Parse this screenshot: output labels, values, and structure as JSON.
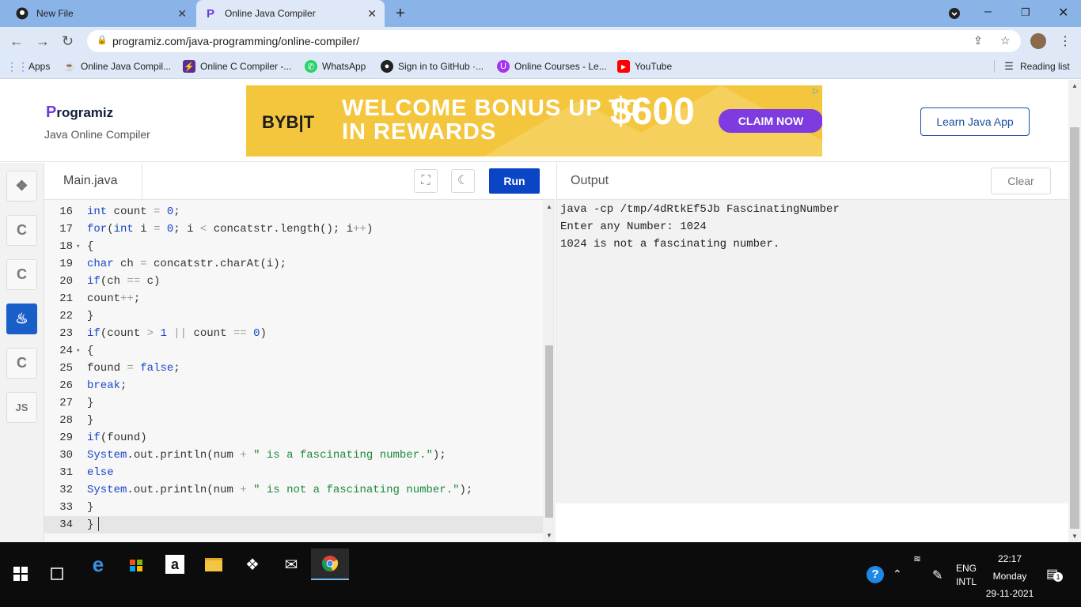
{
  "browser": {
    "tabs": [
      {
        "title": "New File"
      },
      {
        "title": "Online Java Compiler"
      }
    ],
    "url": "programiz.com/java-programming/online-compiler/",
    "bookmarks": [
      {
        "label": "Apps",
        "icon": "apps-grid-icon",
        "color": "#4285f4"
      },
      {
        "label": "Online Java Compil...",
        "icon": "java-cup-icon",
        "color": "#333333"
      },
      {
        "label": "Online C Compiler -...",
        "icon": "bolt-icon",
        "color": "#5b2d91"
      },
      {
        "label": "WhatsApp",
        "icon": "whatsapp-icon",
        "color": "#25d366"
      },
      {
        "label": "Sign in to GitHub ·...",
        "icon": "github-icon",
        "color": "#222222"
      },
      {
        "label": "Online Courses - Le...",
        "icon": "udemy-icon",
        "color": "#a435f0"
      },
      {
        "label": "YouTube",
        "icon": "youtube-icon",
        "color": "#ff0000"
      }
    ],
    "reading_list": "Reading list"
  },
  "site": {
    "logo_text": "rogramiz",
    "logo_letter": "P",
    "subtitle": "Java Online Compiler",
    "ad": {
      "brand": "BYB|T",
      "headline_1": "WELCOME BONUS UP TO",
      "headline_2": "IN REWARDS",
      "amount": "$600",
      "cta": "CLAIM NOW"
    },
    "learn_button": "Learn Java App"
  },
  "sidebar": {
    "languages": [
      {
        "name": "python",
        "glyph": "❖"
      },
      {
        "name": "c",
        "glyph": "C"
      },
      {
        "name": "cpp",
        "glyph": "C"
      },
      {
        "name": "java",
        "glyph": "♨",
        "active": true
      },
      {
        "name": "csharp",
        "glyph": "C"
      },
      {
        "name": "javascript",
        "glyph": "JS"
      }
    ]
  },
  "editor": {
    "filename": "Main.java",
    "run_label": "Run",
    "lines": [
      {
        "n": "16",
        "fold": false,
        "html": "<span class='kw'>int</span> count <span class='op'>=</span> <span class='num2'>0</span>;"
      },
      {
        "n": "17",
        "fold": false,
        "html": "<span class='kw'>for</span>(<span class='kw'>int</span> i <span class='op'>=</span> <span class='num2'>0</span>; i <span class='op'>&lt;</span> concatstr.length(); i<span class='op'>++</span>)"
      },
      {
        "n": "18",
        "fold": true,
        "html": "{"
      },
      {
        "n": "19",
        "fold": false,
        "html": "<span class='kw'>char</span> ch <span class='op'>=</span> concatstr.charAt(i);"
      },
      {
        "n": "20",
        "fold": false,
        "html": "<span class='kw'>if</span>(ch <span class='op'>==</span> c)"
      },
      {
        "n": "21",
        "fold": false,
        "html": "count<span class='op'>++</span>;"
      },
      {
        "n": "22",
        "fold": false,
        "html": "}"
      },
      {
        "n": "23",
        "fold": false,
        "html": "<span class='kw'>if</span>(count <span class='op'>&gt;</span> <span class='num2'>1</span> <span class='op'>||</span> count <span class='op'>==</span> <span class='num2'>0</span>)"
      },
      {
        "n": "24",
        "fold": true,
        "html": "{"
      },
      {
        "n": "25",
        "fold": false,
        "html": "found <span class='op'>=</span> <span class='num2'>false</span>;"
      },
      {
        "n": "26",
        "fold": false,
        "html": "<span class='kw'>break</span>;"
      },
      {
        "n": "27",
        "fold": false,
        "html": "}"
      },
      {
        "n": "28",
        "fold": false,
        "html": "}"
      },
      {
        "n": "29",
        "fold": false,
        "html": "<span class='kw'>if</span>(found)"
      },
      {
        "n": "30",
        "fold": false,
        "html": "<span class='kw'>System</span>.out.println(num <span class='op'>+</span> <span class='str'>\" is a fascinating number.\"</span>);"
      },
      {
        "n": "31",
        "fold": false,
        "html": "<span class='kw'>else</span>"
      },
      {
        "n": "32",
        "fold": false,
        "html": "<span class='kw'>System</span>.out.println(num <span class='op'>+</span> <span class='str'>\" is not a fascinating number.\"</span>);"
      },
      {
        "n": "33",
        "fold": false,
        "html": "}"
      },
      {
        "n": "34",
        "fold": false,
        "html": "}",
        "current": true
      }
    ]
  },
  "output": {
    "label": "Output",
    "clear_label": "Clear",
    "lines": [
      "java -cp /tmp/4dRtkEf5Jb FascinatingNumber",
      "Enter any Number: 1024",
      "1024 is not a fascinating number."
    ]
  },
  "taskbar": {
    "language": "ENG",
    "layout": "INTL",
    "time": "22:17",
    "day": "Monday",
    "date": "29-11-2021",
    "notifications": "1"
  }
}
